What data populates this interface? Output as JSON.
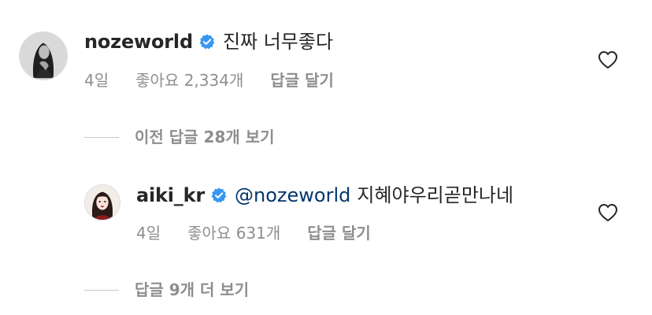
{
  "comments": [
    {
      "username": "nozeworld",
      "verified": true,
      "mention": "",
      "text": "진짜 너무좋다",
      "time": "4일",
      "likes_label": "좋아요",
      "likes_count": "2,334개",
      "reply_label": "답글 달기",
      "icons": {
        "verified": "verified-badge-icon",
        "like": "heart-icon"
      }
    },
    {
      "username": "aiki_kr",
      "verified": true,
      "mention": "@nozeworld",
      "text": "지혜야우리곧만나네",
      "time": "4일",
      "likes_label": "좋아요",
      "likes_count": "631개",
      "reply_label": "답글 달기",
      "icons": {
        "verified": "verified-badge-icon",
        "like": "heart-icon"
      }
    }
  ],
  "threads": {
    "previous_replies": "이전 답글 28개 보기",
    "more_replies": "답글 9개 더 보기"
  },
  "colors": {
    "text": "#262626",
    "secondary": "#8e8e8e",
    "mention": "#00376b",
    "verified": "#3897f0",
    "divider": "#c7c7c7"
  }
}
